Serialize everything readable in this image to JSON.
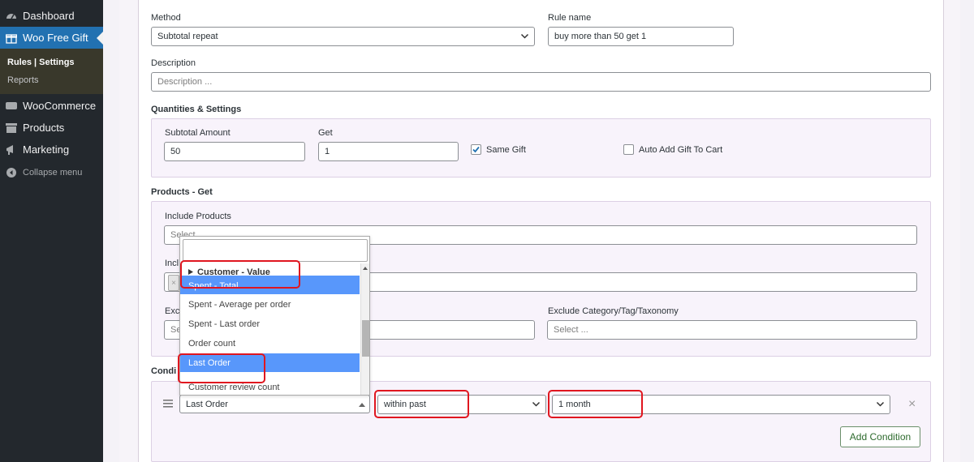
{
  "sidebar": {
    "items": [
      {
        "label": "Dashboard",
        "icon": "dashboard-icon"
      },
      {
        "label": "Woo Free Gift",
        "icon": "gift-icon"
      },
      {
        "label": "WooCommerce",
        "icon": "woo-icon"
      },
      {
        "label": "Products",
        "icon": "archive-icon"
      },
      {
        "label": "Marketing",
        "icon": "megaphone-icon"
      },
      {
        "label": "Collapse menu",
        "icon": "collapse-icon"
      }
    ],
    "submenu": [
      "Rules | Settings",
      "Reports"
    ]
  },
  "form": {
    "method_label": "Method",
    "method_value": "Subtotal repeat",
    "rule_name_label": "Rule name",
    "rule_name_value": "buy more than 50 get 1",
    "description_label": "Description",
    "description_placeholder": "Description ...",
    "quantities_title": "Quantities & Settings",
    "subtotal_label": "Subtotal Amount",
    "subtotal_value": "50",
    "get_label": "Get",
    "get_value": "1",
    "same_gift_label": "Same Gift",
    "same_gift_checked": true,
    "auto_add_label": "Auto Add Gift To Cart",
    "auto_add_checked": false,
    "products_title": "Products - Get",
    "include_products_label": "Include Products",
    "include_products_placeholder": "Select",
    "include_category_label_partial": "Incl",
    "exclude_products_label_partial": "Exc",
    "exclude_products_placeholder_partial": "Se",
    "exclude_category_label": "Exclude Category/Tag/Taxonomy",
    "exclude_category_placeholder": "Select ...",
    "conditions_title_partial": "Condi",
    "condition_field_value": "Last Order",
    "condition_operator_value": "within past",
    "condition_period_value": "1 month",
    "remove_symbol": "×",
    "tag_remove_symbol": "×",
    "add_condition_label": "Add Condition"
  },
  "dropdown": {
    "group_label": "Customer - Value",
    "items": [
      {
        "label": "Spent - Total",
        "highlighted": true
      },
      {
        "label": "Spent - Average per order",
        "highlighted": false
      },
      {
        "label": "Spent - Last order",
        "highlighted": false
      },
      {
        "label": "Order count",
        "highlighted": false
      },
      {
        "label": "Last Order",
        "highlighted": true
      },
      {
        "label": "Customer review count",
        "highlighted": false
      }
    ]
  },
  "colors": {
    "sidebar_bg": "#23282d",
    "active_menu": "#2271b1",
    "highlight": "#5897fb",
    "callout_red": "#e0161f",
    "section_bg": "#f8f3fb"
  }
}
